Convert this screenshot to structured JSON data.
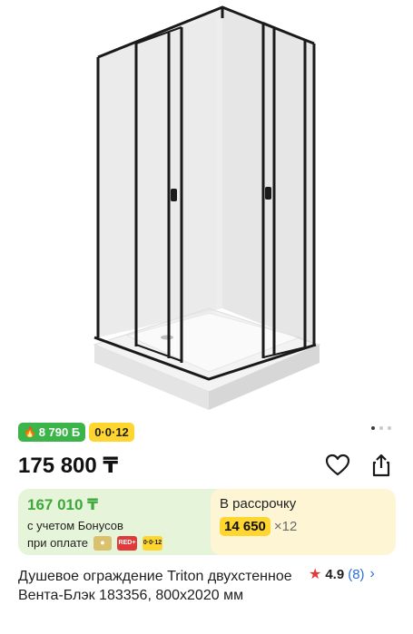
{
  "product": {
    "image_alt": "shower-enclosure-photo",
    "gallery_dots": [
      true,
      false,
      false
    ]
  },
  "badges": {
    "bonus_points": "8 790 Б",
    "installment_tag": "0·0·12"
  },
  "price": {
    "main": "175 800 ₸"
  },
  "bonus_card": {
    "price": "167 010 ₸",
    "note": "с учетом Бонусов",
    "pay_label": "при оплате",
    "chips": [
      "RED+",
      "0·0·12"
    ]
  },
  "installment_card": {
    "title": "В рассрочку",
    "amount": "14 650",
    "times": "×12"
  },
  "title": {
    "text": "Душевое ограждение Triton двухстенное Вента-Блэк 183356, 800x2020 мм"
  },
  "rating": {
    "value": "4.9",
    "count": "(8)"
  },
  "colors": {
    "green": "#3bb54a",
    "yellow": "#ffd530",
    "link": "#2b6fd6",
    "star": "#e03a3a"
  }
}
